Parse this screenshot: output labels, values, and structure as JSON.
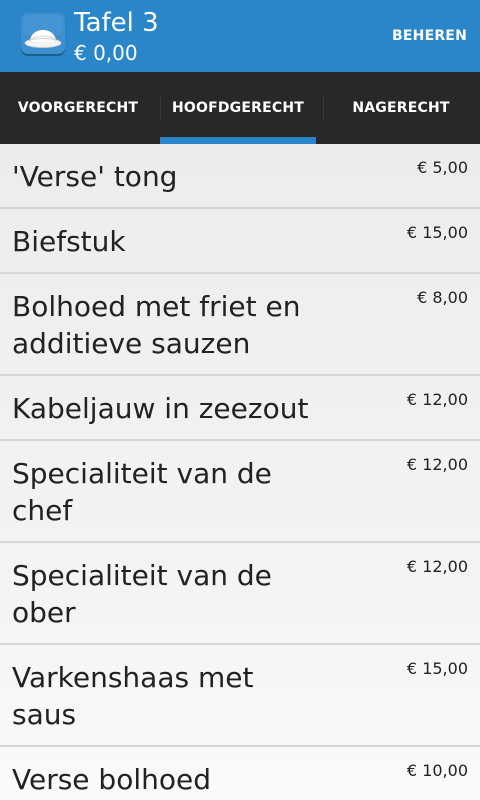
{
  "app": {
    "icon": "bowler-hat-icon",
    "title": "Tafel 3",
    "subtitle": "€ 0,00",
    "action_label": "BEHEREN"
  },
  "colors": {
    "app_bar": "#2a86c8",
    "tab_bar": "#282828",
    "tab_indicator": "#2a86c8",
    "list_background": "#f3f3f3"
  },
  "tabs": [
    {
      "label": "VOORGERECHT",
      "selected": false
    },
    {
      "label": "HOOFDGERECHT",
      "selected": true
    },
    {
      "label": "NAGERECHT",
      "selected": false
    }
  ],
  "menu": {
    "items": [
      {
        "name": "'Verse' tong",
        "price": "€ 5,00"
      },
      {
        "name": "Biefstuk",
        "price": "€ 15,00"
      },
      {
        "name": "Bolhoed met friet en additieve sauzen",
        "price": "€ 8,00"
      },
      {
        "name": "Kabeljauw in zeezout",
        "price": "€ 12,00"
      },
      {
        "name": "Specialiteit van de chef",
        "price": "€ 12,00"
      },
      {
        "name": "Specialiteit van de ober",
        "price": "€ 12,00"
      },
      {
        "name": "Varkenshaas met saus",
        "price": "€ 15,00"
      },
      {
        "name": "Verse bolhoed",
        "price": "€ 10,00"
      }
    ]
  }
}
